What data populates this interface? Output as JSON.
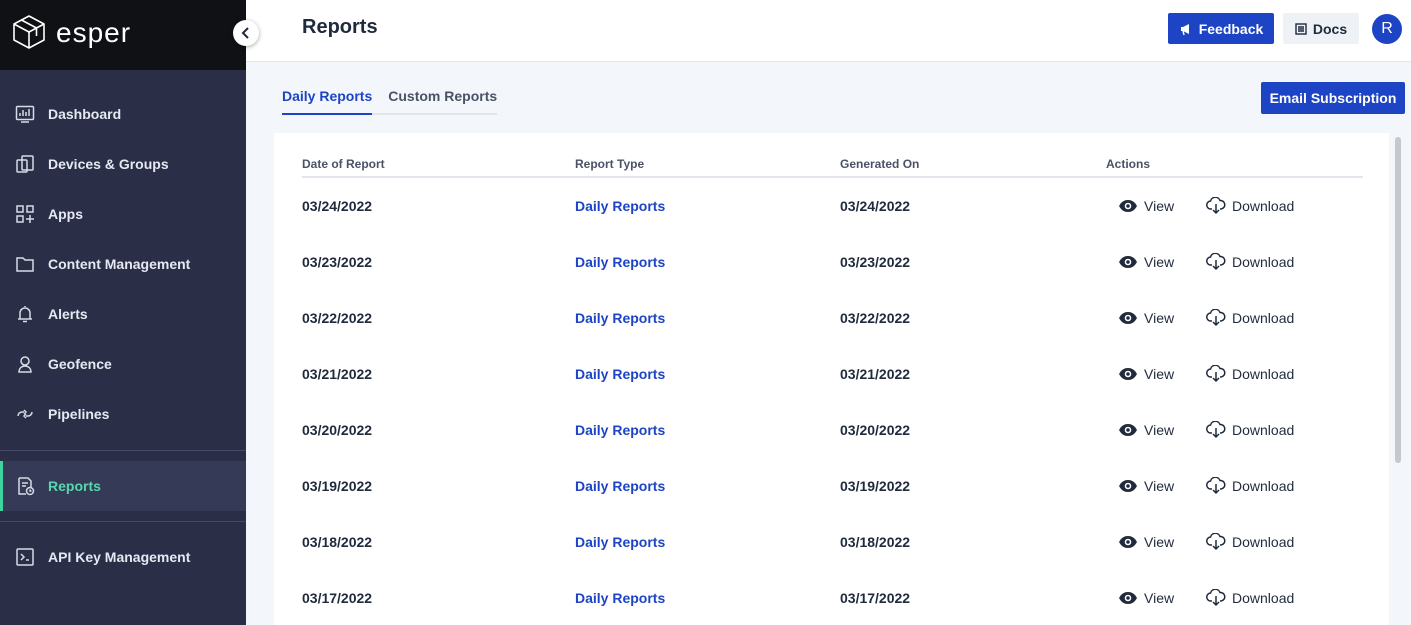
{
  "brand": {
    "name": "esper"
  },
  "sidebar": {
    "items": [
      {
        "id": "dashboard",
        "label": "Dashboard",
        "icon": "dashboard-icon"
      },
      {
        "id": "devices",
        "label": "Devices & Groups",
        "icon": "devices-icon"
      },
      {
        "id": "apps",
        "label": "Apps",
        "icon": "apps-icon"
      },
      {
        "id": "content",
        "label": "Content Management",
        "icon": "folder-icon"
      },
      {
        "id": "alerts",
        "label": "Alerts",
        "icon": "bell-icon"
      },
      {
        "id": "geofence",
        "label": "Geofence",
        "icon": "geofence-icon"
      },
      {
        "id": "pipelines",
        "label": "Pipelines",
        "icon": "pipelines-icon"
      },
      {
        "id": "reports",
        "label": "Reports",
        "icon": "reports-icon",
        "active": true
      },
      {
        "id": "api",
        "label": "API Key Management",
        "icon": "terminal-icon"
      }
    ]
  },
  "header": {
    "title": "Reports",
    "feedback_label": "Feedback",
    "docs_label": "Docs",
    "avatar_initial": "R"
  },
  "tabs": [
    {
      "label": "Daily Reports",
      "active": true
    },
    {
      "label": "Custom Reports",
      "active": false
    }
  ],
  "email_subscription_label": "Email Subscription",
  "table": {
    "columns": [
      "Date of Report",
      "Report Type",
      "Generated On",
      "Actions"
    ],
    "view_label": "View",
    "download_label": "Download",
    "rows": [
      {
        "date": "03/24/2022",
        "type": "Daily Reports",
        "generated": "03/24/2022"
      },
      {
        "date": "03/23/2022",
        "type": "Daily Reports",
        "generated": "03/23/2022"
      },
      {
        "date": "03/22/2022",
        "type": "Daily Reports",
        "generated": "03/22/2022"
      },
      {
        "date": "03/21/2022",
        "type": "Daily Reports",
        "generated": "03/21/2022"
      },
      {
        "date": "03/20/2022",
        "type": "Daily Reports",
        "generated": "03/20/2022"
      },
      {
        "date": "03/19/2022",
        "type": "Daily Reports",
        "generated": "03/19/2022"
      },
      {
        "date": "03/18/2022",
        "type": "Daily Reports",
        "generated": "03/18/2022"
      },
      {
        "date": "03/17/2022",
        "type": "Daily Reports",
        "generated": "03/17/2022"
      }
    ]
  },
  "colors": {
    "sidebar_bg": "#2a2f47",
    "brand_bg": "#0f1115",
    "accent": "#1d44c4",
    "active_nav": "#58d7ad"
  }
}
